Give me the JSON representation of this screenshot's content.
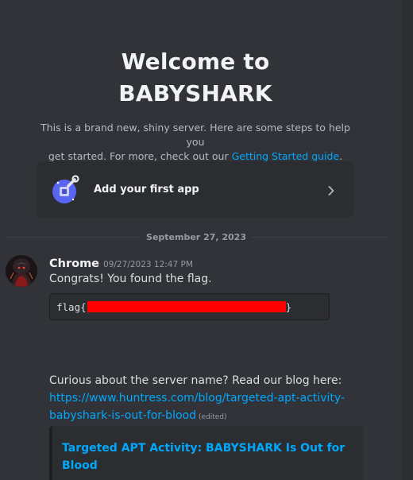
{
  "welcome": {
    "title_line1": "Welcome to",
    "title_line2": "BABYSHARK",
    "desc_line1": "This is a brand new, shiny server. Here are some steps to help you",
    "desc_line2_prefix": "get started. For more, check out our ",
    "desc_link": "Getting Started guide",
    "desc_suffix": "."
  },
  "app_card": {
    "label": "Add your first app",
    "icon": "app-wrench-icon",
    "chevron": "chevron-right-icon"
  },
  "date_divider": "September 27, 2023",
  "message": {
    "author": "Chrome",
    "timestamp": "09/27/2023 12:47 PM",
    "line1": "Congrats! You found the flag.",
    "code_prefix": "flag{",
    "code_suffix": "}",
    "line2": "Curious about the server name? Read our blog here:",
    "link_line1": "https://www.huntress.com/blog/targeted-apt-activity-",
    "link_line2": "babyshark-is-out-for-blood",
    "edited": "(edited)"
  },
  "embed": {
    "title": "Targeted APT Activity: BABYSHARK Is Out for Blood"
  },
  "colors": {
    "background": "#313338",
    "link": "#00a8fc",
    "redaction": "#ff0000"
  }
}
